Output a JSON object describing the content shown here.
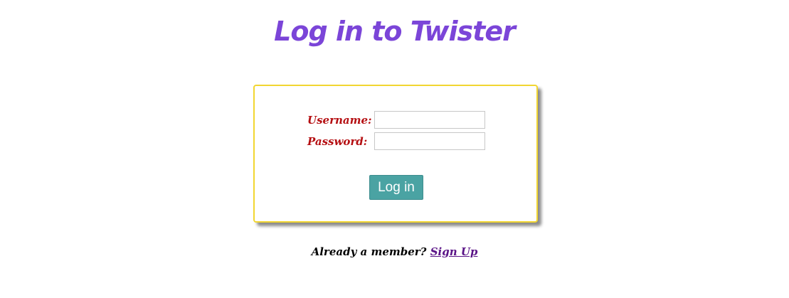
{
  "header": {
    "title": "Log in to Twister"
  },
  "login_form": {
    "username_label": "Username:",
    "username_value": "",
    "password_label": "Password:",
    "password_value": "",
    "submit_label": "Log in"
  },
  "footer": {
    "prompt": "Already a member?",
    "signup_link": "Sign Up"
  },
  "colors": {
    "title": "#7b45d8",
    "labels": "#b50f12",
    "card_border": "#f2d631",
    "button": "#4aa3a3",
    "link": "#5a1487"
  }
}
